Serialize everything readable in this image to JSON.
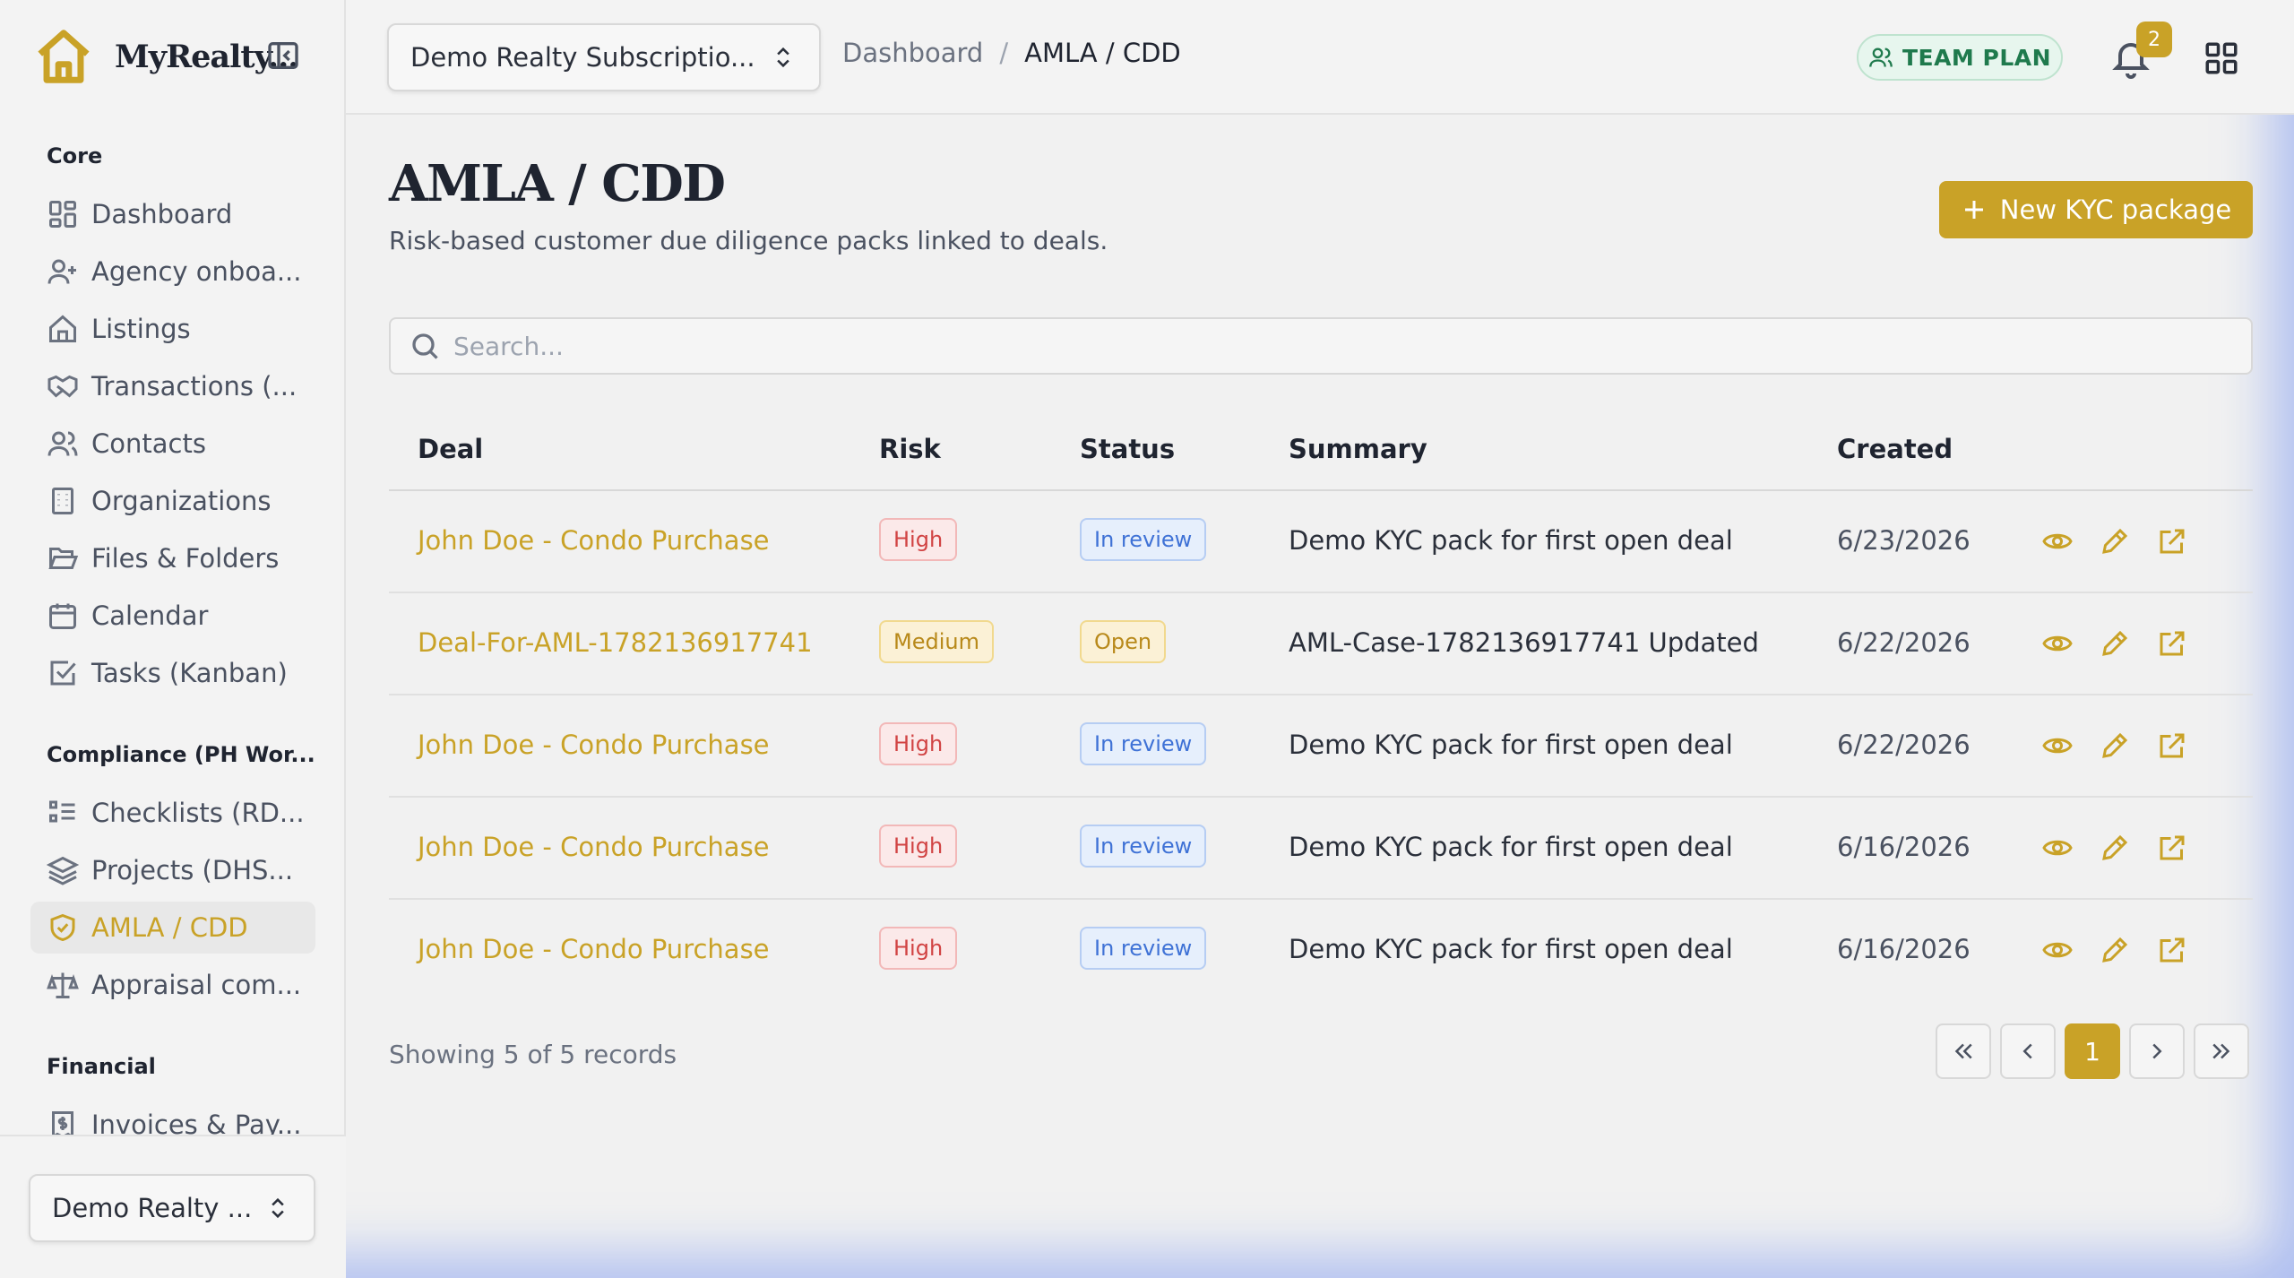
{
  "app": {
    "brand": "MyRealty...",
    "accent": "#c9a227"
  },
  "sidebar": {
    "sections": [
      {
        "title": "Core"
      },
      {
        "title": "Compliance (PH Wor..."
      },
      {
        "title": "Financial"
      }
    ],
    "items": [
      {
        "label": "Dashboard",
        "icon": "dashboard-grid-icon"
      },
      {
        "label": "Agency onboa...",
        "icon": "user-plus-icon"
      },
      {
        "label": "Listings",
        "icon": "house-icon"
      },
      {
        "label": "Transactions (...",
        "icon": "handshake-icon"
      },
      {
        "label": "Contacts",
        "icon": "users-icon"
      },
      {
        "label": "Organizations",
        "icon": "building-icon"
      },
      {
        "label": "Files & Folders",
        "icon": "folder-open-icon"
      },
      {
        "label": "Calendar",
        "icon": "calendar-icon"
      },
      {
        "label": "Tasks (Kanban)",
        "icon": "checkbox-icon"
      },
      {
        "label": "Checklists (RD...",
        "icon": "list-checks-icon"
      },
      {
        "label": "Projects (DHS...",
        "icon": "layers-icon"
      },
      {
        "label": "AMLA / CDD",
        "icon": "shield-check-icon",
        "active": true
      },
      {
        "label": "Appraisal com...",
        "icon": "scale-icon"
      },
      {
        "label": "Invoices & Pay...",
        "icon": "receipt-icon"
      }
    ],
    "org_select": "Demo Realty ..."
  },
  "header": {
    "subscription_select": "Demo Realty Subscriptio...",
    "breadcrumb": {
      "parent": "Dashboard",
      "separator": "/",
      "current": "AMLA / CDD"
    },
    "plan_badge": "TEAM PLAN",
    "notification_count": "2"
  },
  "page": {
    "title": "AMLA / CDD",
    "subtitle": "Risk-based customer due diligence packs linked to deals.",
    "new_button": "New KYC package",
    "search_placeholder": "Search..."
  },
  "table": {
    "columns": [
      "Deal",
      "Risk",
      "Status",
      "Summary",
      "Created"
    ],
    "rows": [
      {
        "deal": "John Doe - Condo Purchase",
        "risk": "High",
        "status": "In review",
        "summary": "Demo KYC pack for first open deal",
        "created": "6/23/2026"
      },
      {
        "deal": "Deal-For-AML-1782136917741",
        "risk": "Medium",
        "status": "Open",
        "summary": "AML-Case-1782136917741 Updated",
        "created": "6/22/2026"
      },
      {
        "deal": "John Doe - Condo Purchase",
        "risk": "High",
        "status": "In review",
        "summary": "Demo KYC pack for first open deal",
        "created": "6/22/2026"
      },
      {
        "deal": "John Doe - Condo Purchase",
        "risk": "High",
        "status": "In review",
        "summary": "Demo KYC pack for first open deal",
        "created": "6/16/2026"
      },
      {
        "deal": "John Doe - Condo Purchase",
        "risk": "High",
        "status": "In review",
        "summary": "Demo KYC pack for first open deal",
        "created": "6/16/2026"
      }
    ]
  },
  "pagination": {
    "summary": "Showing 5 of 5 records",
    "current_page": "1"
  }
}
